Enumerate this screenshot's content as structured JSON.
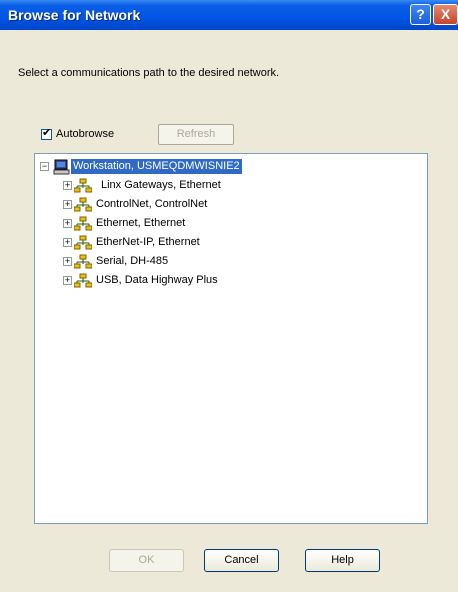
{
  "window": {
    "title": "Browse for Network",
    "help_glyph": "?",
    "close_glyph": "X"
  },
  "instruction": "Select a communications path to the desired network.",
  "autobrowse": {
    "label": "Autobrowse",
    "checked": true,
    "check_glyph": "✔"
  },
  "refresh_label": "Refresh",
  "tree": {
    "root": {
      "label": "Workstation, USMEQDMWISNIE2",
      "icon": "computer-icon",
      "expander": "−"
    },
    "children": [
      {
        "label": "Linx Gateways, Ethernet",
        "icon": "network-icon",
        "expander": "+"
      },
      {
        "label": "ControlNet, ControlNet",
        "icon": "network-icon",
        "expander": "+"
      },
      {
        "label": "Ethernet, Ethernet",
        "icon": "network-icon",
        "expander": "+"
      },
      {
        "label": "EtherNet-IP, Ethernet",
        "icon": "network-icon",
        "expander": "+"
      },
      {
        "label": "Serial, DH-485",
        "icon": "network-icon",
        "expander": "+"
      },
      {
        "label": "USB, Data Highway Plus",
        "icon": "network-icon",
        "expander": "+"
      }
    ]
  },
  "buttons": {
    "ok": "OK",
    "cancel": "Cancel",
    "help": "Help"
  },
  "colors": {
    "title_bar": "#0055e5",
    "selection": "#316ac5",
    "dialog_bg": "#ece9d8"
  }
}
